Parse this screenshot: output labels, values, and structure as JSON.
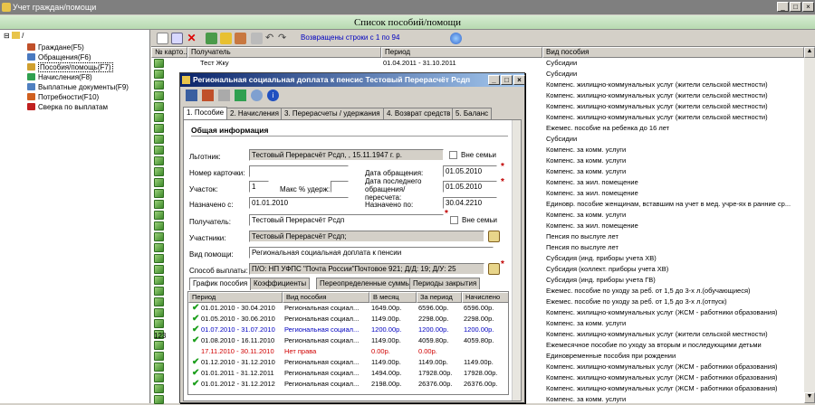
{
  "window": {
    "title": "Учет граждан/помощи"
  },
  "header": {
    "title": "Список пособий/помощи"
  },
  "tree": {
    "root": "/",
    "items": [
      {
        "label": "Граждане(F5)",
        "color": "#c0502a"
      },
      {
        "label": "Обращения(F6)",
        "color": "#4a7ac0"
      },
      {
        "label": "Пособия/помощь(F7)",
        "color": "#d0a030"
      },
      {
        "label": "Начисления(F8)",
        "color": "#30a050"
      },
      {
        "label": "Выплатные документы(F9)",
        "color": "#5080c0"
      },
      {
        "label": "Потребности(F10)",
        "color": "#d06020"
      },
      {
        "label": "Сверка по выплатам",
        "color": "#c02020"
      }
    ]
  },
  "toolbar": {
    "status": "Возвращены строки с 1 по 94"
  },
  "grid": {
    "columns": [
      "№ карто...",
      "Получатель",
      "Период",
      "Вид пособия"
    ],
    "first_row": {
      "who": "Тест Жку",
      "period": "01.04.2011 - 31.10.2011"
    },
    "side_number": "123",
    "vid": [
      "Субсидии",
      "Субсидии",
      "Компенс. жилищно-коммунальных услуг (жители сельской местности)",
      "Компенс. жилищно-коммунальных услуг (жители сельской местности)",
      "Компенс. жилищно-коммунальных услуг (жители сельской местности)",
      "Компенс. жилищно-коммунальных услуг (жители сельской местности)",
      "Ежемес. пособие на ребенка до 16 лет",
      "Субсидии",
      "Компенс. за комм. услуги",
      "Компенс. за комм. услуги",
      "Компенс. за комм. услуги",
      "Компенс. за жил. помещение",
      "Компенс. за жил. помещение",
      "Единовр. пособие женщинам, вставшим на учет в мед. учре-ях в ранние ср...",
      "Компенс. за комм. услуги",
      "Компенс. за жил. помещение",
      "Пенсия по выслуге лет",
      "Пенсия по выслуге лет",
      "Субсидия (инд. приборы учета ХВ)",
      "Субсидия (коллект. приборы учета ХВ)",
      "Субсидия (инд. приборы учета ГВ)",
      "Ежемес. пособие по уходу за реб. от 1,5 до 3-х л.(обучающиеся)",
      "Ежемес. пособие по уходу за реб. от 1,5 до 3-х л.(отпуск)",
      "Компенс. жилищно-коммунальных услуг (ЖСМ - работники образования)",
      "Компенс. за комм. услуги",
      "Компенс. жилищно-коммунальных услуг (жители сельской местности)",
      "Ежемесячное пособие по уходу за вторым и последующими детьми",
      "Единовременные пособия при рождении",
      "Компенс. жилищно-коммунальных услуг (ЖСМ - работники образования)",
      "Компенс. жилищно-коммунальных услуг (ЖСМ - работники образования)",
      "Компенс. жилищно-коммунальных услуг (ЖСМ - работники образования)",
      "Компенс. за комм. услуги"
    ]
  },
  "dialog": {
    "title": "Региональная социальная доплата к пенсис Тестовый Перерасчёт Рсдп",
    "tabs": [
      "1. Пособие",
      "2. Начисления",
      "3. Перерасчеты / удержания",
      "4. Возврат средств",
      "5. Баланс"
    ],
    "section": "Общая информация",
    "lgotnik_label": "Льготник:",
    "lgotnik_value": "Тестовый Перерасчёт Рсдп, , 15.11.1947 г. р.",
    "vne_semi": "Вне семьи",
    "card_label": "Номер карточки:",
    "date_obr_label": "Дата обращения:",
    "date_obr_value": "01.05.2010",
    "uchastok_label": "Участок:",
    "uchastok_value": "1",
    "maks_label": "Макс % удерж:",
    "date_last_label": "Дата последнего обращения/пересчета:",
    "date_last_value": "01.05.2010",
    "nazn_s_label": "Назначено с:",
    "nazn_s_value": "01.01.2010",
    "nazn_po_label": "Назначено по:",
    "nazn_po_value": "30.04.2210",
    "poluch_label": "Получатель:",
    "poluch_value": "Тестовый Перерасчёт Рсдп",
    "vne_semi2": "Вне семьи",
    "uchast_label": "Участники:",
    "uchast_value": "Тестовый Перерасчёт Рсдп;",
    "vid_label": "Вид помощи:",
    "vid_value": "Региональная социальная доплата к пенсии",
    "sposob_label": "Способ выплаты:",
    "sposob_value": "П/О: НП УФПС \"Почта России\"Почтовое 921; Д/Д: 19; Д/У: 25",
    "subtabs": [
      "График пособия",
      "Коэффициенты",
      "Переопределенные суммы",
      "Периоды закрытия"
    ],
    "table_cols": [
      "Период",
      "Вид пособия",
      "В месяц",
      "За период",
      "Начислено"
    ],
    "rows": [
      {
        "p": "01.01.2010 - 30.04.2010",
        "v": "Региональная социал...",
        "m": "1649.00р.",
        "z": "6596.00р.",
        "n": "6596.00р.",
        "s": "ok"
      },
      {
        "p": "01.05.2010 - 30.06.2010",
        "v": "Региональная социал...",
        "m": "1149.00р.",
        "z": "2298.00р.",
        "n": "2298.00р.",
        "s": "ok"
      },
      {
        "p": "01.07.2010 - 31.07.2010",
        "v": "Региональная социал...",
        "m": "1200.00р.",
        "z": "1200.00р.",
        "n": "1200.00р.",
        "s": "blue"
      },
      {
        "p": "01.08.2010 - 16.11.2010",
        "v": "Региональная социал...",
        "m": "1149.00р.",
        "z": "4059.80р.",
        "n": "4059.80р.",
        "s": "ok"
      },
      {
        "p": "17.11.2010 - 30.11.2010",
        "v": "Нет права",
        "m": "0.00р.",
        "z": "0.00р.",
        "n": "",
        "s": "red"
      },
      {
        "p": "01.12.2010 - 31.12.2010",
        "v": "Региональная социал...",
        "m": "1149.00р.",
        "z": "1149.00р.",
        "n": "1149.00р.",
        "s": "ok"
      },
      {
        "p": "01.01.2011 - 31.12.2011",
        "v": "Региональная социал...",
        "m": "1494.00р.",
        "z": "17928.00р.",
        "n": "17928.00р.",
        "s": "ok"
      },
      {
        "p": "01.01.2012 - 31.12.2012",
        "v": "Региональная социал...",
        "m": "2198.00р.",
        "z": "26376.00р.",
        "n": "26376.00р.",
        "s": "ok"
      }
    ]
  }
}
